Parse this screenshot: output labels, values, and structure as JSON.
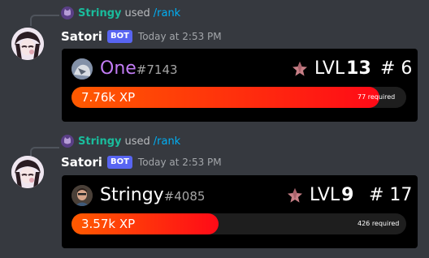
{
  "messages": [
    {
      "reply": {
        "user": "Stringy",
        "used": "used",
        "command": "/rank"
      },
      "author": "Satori",
      "bot_badge": "BOT",
      "timestamp": "Today at 2:53 PM",
      "card": {
        "username": "One",
        "discriminator": "#7143",
        "username_color": "#c27cf5",
        "level_label": "LVL",
        "level": "13",
        "rank": "# 6",
        "xp": "7.76k XP",
        "required": "77 required",
        "progress": 0.92
      }
    },
    {
      "reply": {
        "user": "Stringy",
        "used": "used",
        "command": "/rank"
      },
      "author": "Satori",
      "bot_badge": "BOT",
      "timestamp": "Today at 2:53 PM",
      "card": {
        "username": "Stringy",
        "discriminator": "#4085",
        "username_color": "#ffffff",
        "level_label": "LVL",
        "level": "9",
        "rank": "# 17",
        "xp": "3.57k XP",
        "required": "426 required",
        "progress": 0.44
      }
    }
  ],
  "colors": {
    "background": "#36393f",
    "card": "#000000",
    "bot_badge": "#5865f2",
    "reply_user": "#1abc9c",
    "command": "#00aff4"
  },
  "icons": {
    "reply_avatar": "cat-icon",
    "level": "pink-star-icon"
  }
}
